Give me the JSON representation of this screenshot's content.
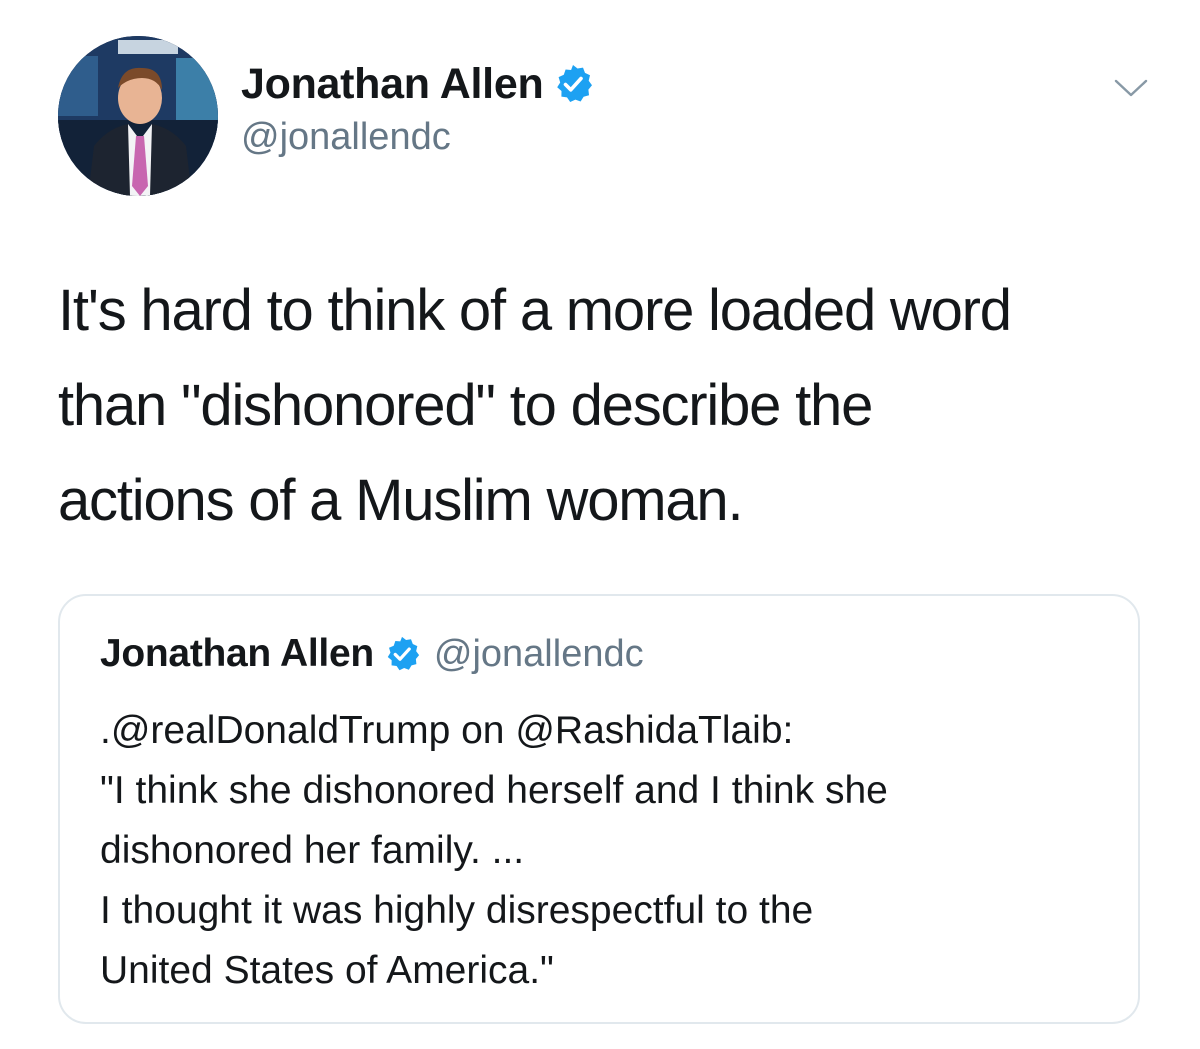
{
  "tweet": {
    "author": {
      "display_name": "Jonathan Allen",
      "handle": "@jonallendc",
      "verified_icon": "verified-badge-icon"
    },
    "menu_icon": "chevron-down-icon",
    "text_lines": [
      "It's hard to think of a more loaded word",
      "than \"dishonored\" to describe the",
      "actions of a Muslim woman."
    ]
  },
  "quoted_tweet": {
    "author": {
      "display_name": "Jonathan Allen",
      "handle": "@jonallendc",
      "verified_icon": "verified-badge-icon"
    },
    "text_lines": [
      ".@realDonaldTrump on @RashidaTlaib:",
      "\"I think she dishonored herself and I think she",
      "dishonored her family. ...",
      "I thought it was highly disrespectful to the",
      "United States of America.\""
    ]
  },
  "colors": {
    "text_primary": "#14171a",
    "text_secondary": "#657786",
    "verified_blue": "#1da1f2",
    "border": "#e1e8ed"
  }
}
